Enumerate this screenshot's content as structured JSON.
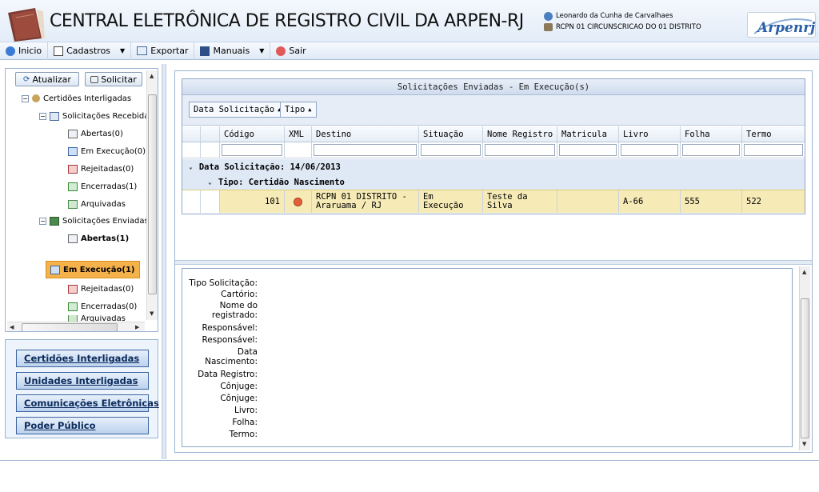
{
  "header": {
    "title": "CENTRAL ELETRÔNICA DE REGISTRO CIVIL DA ARPEN-RJ",
    "user_name": "Leonardo da Cunha de Carvalhaes",
    "user_office": "RCPN 01 CIRCUNSCRICAO DO 01 DISTRITO",
    "brand": "Arpenrj"
  },
  "toolbar": {
    "items": [
      {
        "label": "Inicio",
        "icon": "home-icon"
      },
      {
        "label": "Cadastros",
        "icon": "edit-icon"
      },
      {
        "label": "Exportar",
        "icon": "export-icon"
      },
      {
        "label": "Manuais",
        "icon": "book-icon"
      },
      {
        "label": "Sair",
        "icon": "exit-icon"
      }
    ]
  },
  "left": {
    "refresh_label": "Atualizar",
    "request_label": "Solicitar",
    "tree": [
      "Certidões Interligadas",
      "Solicitações Recebidas",
      "Abertas(0)",
      "Em Execução(0)",
      "Rejeitadas(0)",
      "Encerradas(1)",
      "Arquivadas",
      "Solicitações Enviadas",
      "Abertas(1)",
      "Em Execução(1)",
      "Rejeitadas(0)",
      "Encerradas(0)",
      "Arquivadas"
    ],
    "nav": [
      "Certidões Interligadas",
      "Unidades Interligadas",
      "Comunicações Eletrônicas",
      "Poder Público"
    ]
  },
  "grid": {
    "title": "Solicitações Enviadas - Em Execução(s)",
    "group_chips": [
      "Data Solicitação",
      "Tipo"
    ],
    "columns": [
      "Código",
      "XML",
      "Destino",
      "Situação",
      "Nome Registro",
      "Matricula",
      "Livro",
      "Folha",
      "Termo"
    ],
    "group1": "Data Solicitação: 14/06/2013",
    "group2": "Tipo: Certidão Nascimento",
    "row": {
      "codigo": "101",
      "destino": "RCPN 01 DISTRITO - Araruama / RJ",
      "situacao": "Em Execução",
      "nome": "Teste da Silva",
      "matricula": "",
      "livro": "A-66",
      "folha": "555",
      "termo": "522"
    }
  },
  "detail": {
    "labels": [
      "Tipo Solicitação:",
      "Cartório:",
      "Nome do registrado:",
      "Responsável:",
      "Responsável:",
      "Data Nascimento:",
      "Data Registro:",
      "Cônjuge:",
      "Cônjuge:",
      "Livro:",
      "Folha:",
      "Termo:"
    ]
  },
  "colors": {
    "accent": "#3b64a0",
    "selected_row": "#f6ebb6",
    "selected_tree": "#f5b24a"
  }
}
